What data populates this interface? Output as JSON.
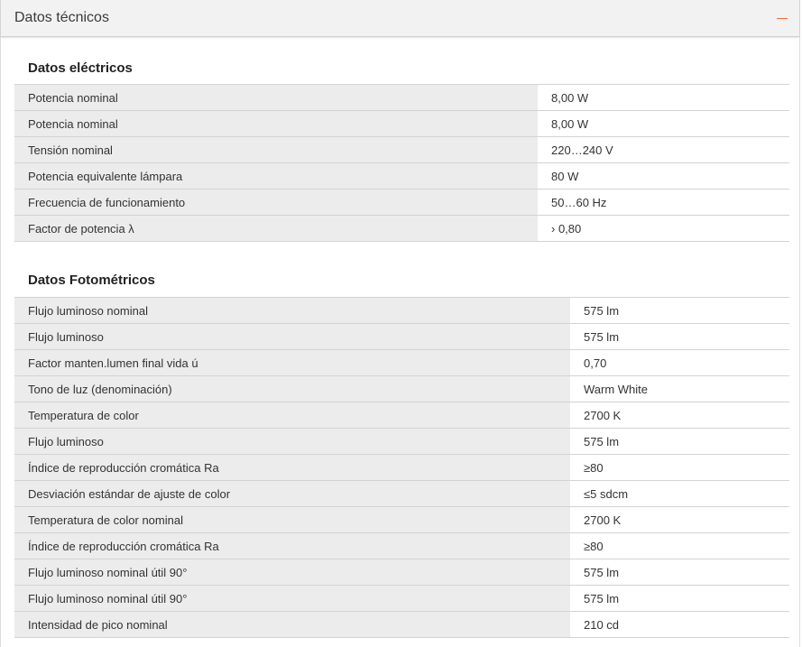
{
  "header": {
    "title": "Datos técnicos",
    "accent_color": "#e8743b"
  },
  "sections": [
    {
      "title": "Datos eléctricos",
      "rows": [
        {
          "label": "Potencia nominal",
          "value": "8,00 W"
        },
        {
          "label": "Potencia nominal",
          "value": "8,00 W"
        },
        {
          "label": "Tensión nominal",
          "value": "220…240 V"
        },
        {
          "label": "Potencia equivalente lámpara",
          "value": "80 W"
        },
        {
          "label": "Frecuencia de funcionamiento",
          "value": "50…60 Hz"
        },
        {
          "label": "Factor de potencia λ",
          "value": "› 0,80"
        }
      ]
    },
    {
      "title": "Datos Fotométricos",
      "rows": [
        {
          "label": "Flujo luminoso nominal",
          "value": "575 lm"
        },
        {
          "label": "Flujo luminoso",
          "value": "575 lm"
        },
        {
          "label": "Factor manten.lumen final vida ú",
          "value": "0,70"
        },
        {
          "label": "Tono de luz (denominación)",
          "value": "Warm White"
        },
        {
          "label": "Temperatura de color",
          "value": "2700 K"
        },
        {
          "label": "Flujo luminoso",
          "value": "575 lm"
        },
        {
          "label": "Índice de reproducción cromática Ra",
          "value": "≥80"
        },
        {
          "label": "Desviación estándar de ajuste de color",
          "value": "≤5 sdcm"
        },
        {
          "label": "Temperatura de color nominal",
          "value": "2700 K"
        },
        {
          "label": "Índice de reproducción cromática Ra",
          "value": "≥80"
        },
        {
          "label": "Flujo luminoso nominal útil 90°",
          "value": "575 lm"
        },
        {
          "label": "Flujo luminoso nominal útil 90°",
          "value": "575 lm"
        },
        {
          "label": "Intensidad de pico nominal",
          "value": "210 cd"
        }
      ]
    }
  ]
}
